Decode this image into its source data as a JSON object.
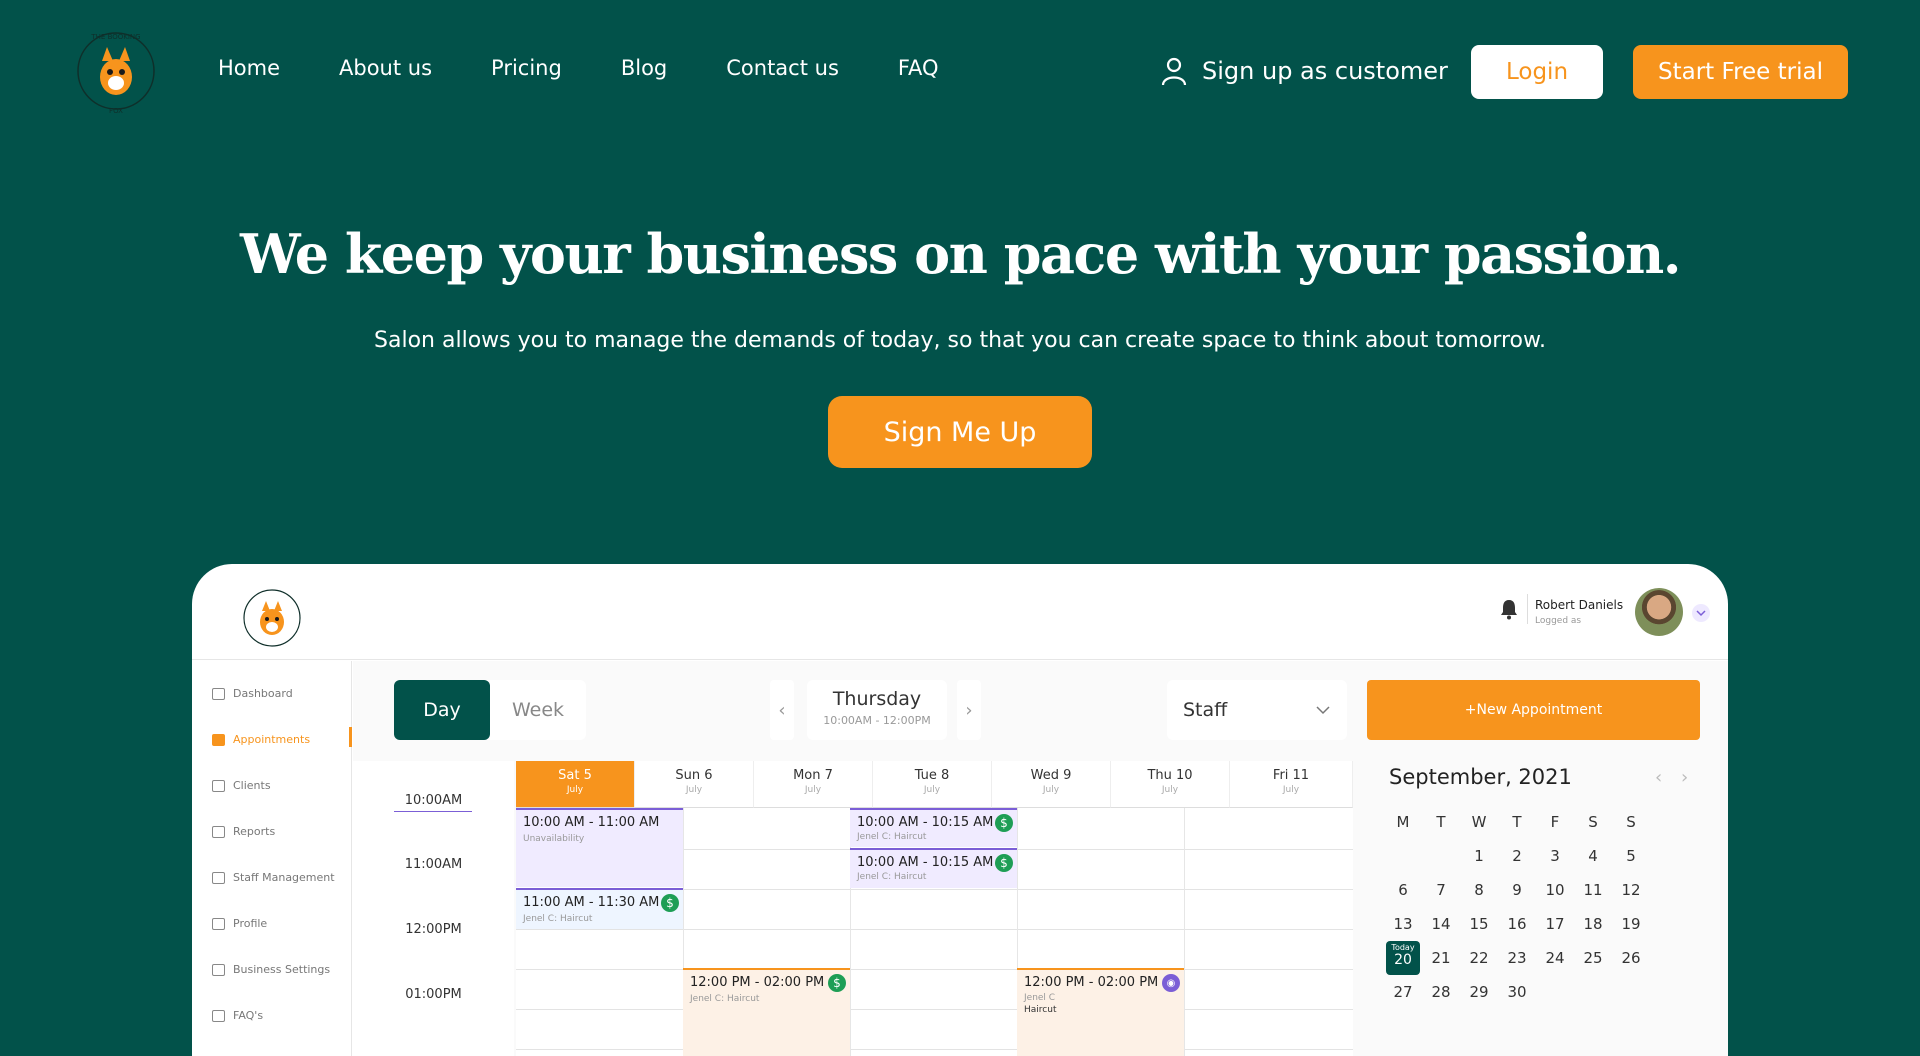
{
  "nav": {
    "items": [
      "Home",
      "About us",
      "Pricing",
      "Blog",
      "Contact us",
      "FAQ"
    ],
    "signup_customer": "Sign up as customer",
    "login": "Login",
    "free_trial": "Start Free trial"
  },
  "brand": {
    "logo_text": "THE BOOKING FOX",
    "accent": "#f7941d",
    "primary": "#02524a"
  },
  "hero": {
    "title": "We keep your business on pace with your passion.",
    "subtitle": "Salon allows you to manage the demands of today, so that you can create space to think about tomorrow.",
    "cta": "Sign Me Up"
  },
  "app": {
    "user": {
      "name": "Robert Daniels",
      "role": "Logged as"
    },
    "sidebar": [
      "Dashboard",
      "Appointments",
      "Clients",
      "Reports",
      "Staff Management",
      "Profile",
      "Business Settings",
      "FAQ's"
    ],
    "view": {
      "day": "Day",
      "week": "Week"
    },
    "current_day": {
      "name": "Thursday",
      "range": "10:00AM - 12:00PM"
    },
    "staff_select": "Staff",
    "new_appointment": "+New Appointment",
    "days": [
      {
        "name": "Sat 5",
        "month": "July"
      },
      {
        "name": "Sun 6",
        "month": "July"
      },
      {
        "name": "Mon 7",
        "month": "July"
      },
      {
        "name": "Tue 8",
        "month": "July"
      },
      {
        "name": "Wed 9",
        "month": "July"
      },
      {
        "name": "Thu 10",
        "month": "July"
      },
      {
        "name": "Fri 11",
        "month": "July"
      }
    ],
    "times": [
      "10:00AM",
      "11:00AM",
      "12:00PM",
      "01:00PM"
    ],
    "events": {
      "e1": {
        "time": "10:00 AM - 11:00 AM",
        "note": "Unavailability"
      },
      "e2": {
        "time": "11:00 AM - 11:30 AM",
        "note": "Jenel C: Haircut"
      },
      "e3": {
        "time": "10:00 AM - 10:15 AM",
        "note": "Jenel C: Haircut"
      },
      "e4": {
        "time": "10:00 AM - 10:15 AM",
        "note": "Jenel C: Haircut"
      },
      "e5": {
        "time": "12:00 PM - 02:00 PM",
        "note": "Jenel C: Haircut"
      },
      "e6": {
        "time": "12:00 PM - 02:00 PM",
        "note": "Jenel C",
        "note2": "Haircut"
      }
    },
    "mini_calendar": {
      "title": "September, 2021",
      "weekdays": [
        "M",
        "T",
        "W",
        "T",
        "F",
        "S",
        "S"
      ],
      "today_label": "Today",
      "today": "20",
      "weeks": [
        [
          "",
          "",
          "1",
          "2",
          "3",
          "4",
          "5"
        ],
        [
          "6",
          "7",
          "8",
          "9",
          "10",
          "11",
          "12"
        ],
        [
          "13",
          "14",
          "15",
          "16",
          "17",
          "18",
          "19"
        ],
        [
          "20",
          "21",
          "22",
          "23",
          "24",
          "25",
          "26"
        ],
        [
          "27",
          "28",
          "29",
          "30",
          "",
          "",
          ""
        ]
      ]
    }
  }
}
